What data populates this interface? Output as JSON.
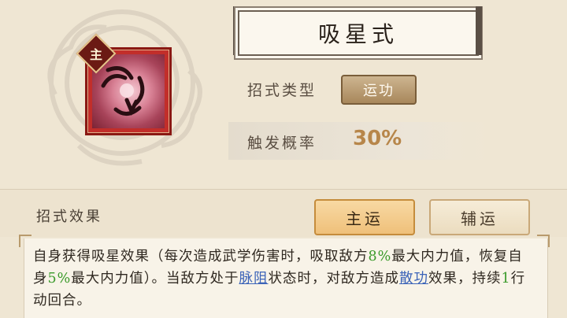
{
  "skill": {
    "name": "吸星式",
    "badge": "主",
    "icon": "vortex-claw-icon"
  },
  "rows": {
    "type_label": "招式类型",
    "type_value": "运功",
    "prob_label": "触发概率",
    "prob_value": "30%"
  },
  "effects": {
    "label": "招式效果",
    "tabs": [
      {
        "label": "主运",
        "selected": true
      },
      {
        "label": "辅运",
        "selected": false
      }
    ],
    "description": {
      "p1": "自身获得吸星效果（每次造成武学伤害时，吸取敌方",
      "v1": "8%",
      "p2": "最大内力值，恢复自身",
      "v2": "5%",
      "p3": "最大内力值）。当敌方处于",
      "link1": "脉阻",
      "p4": "状态时，对敌方造成",
      "link2": "散功",
      "p5": "效果，持续",
      "v3": "1",
      "p6": "行动回合。"
    }
  },
  "colors": {
    "highlight_number": "#3a9a2a",
    "link": "#3b63b8",
    "selected_tab": "#efc07a"
  }
}
